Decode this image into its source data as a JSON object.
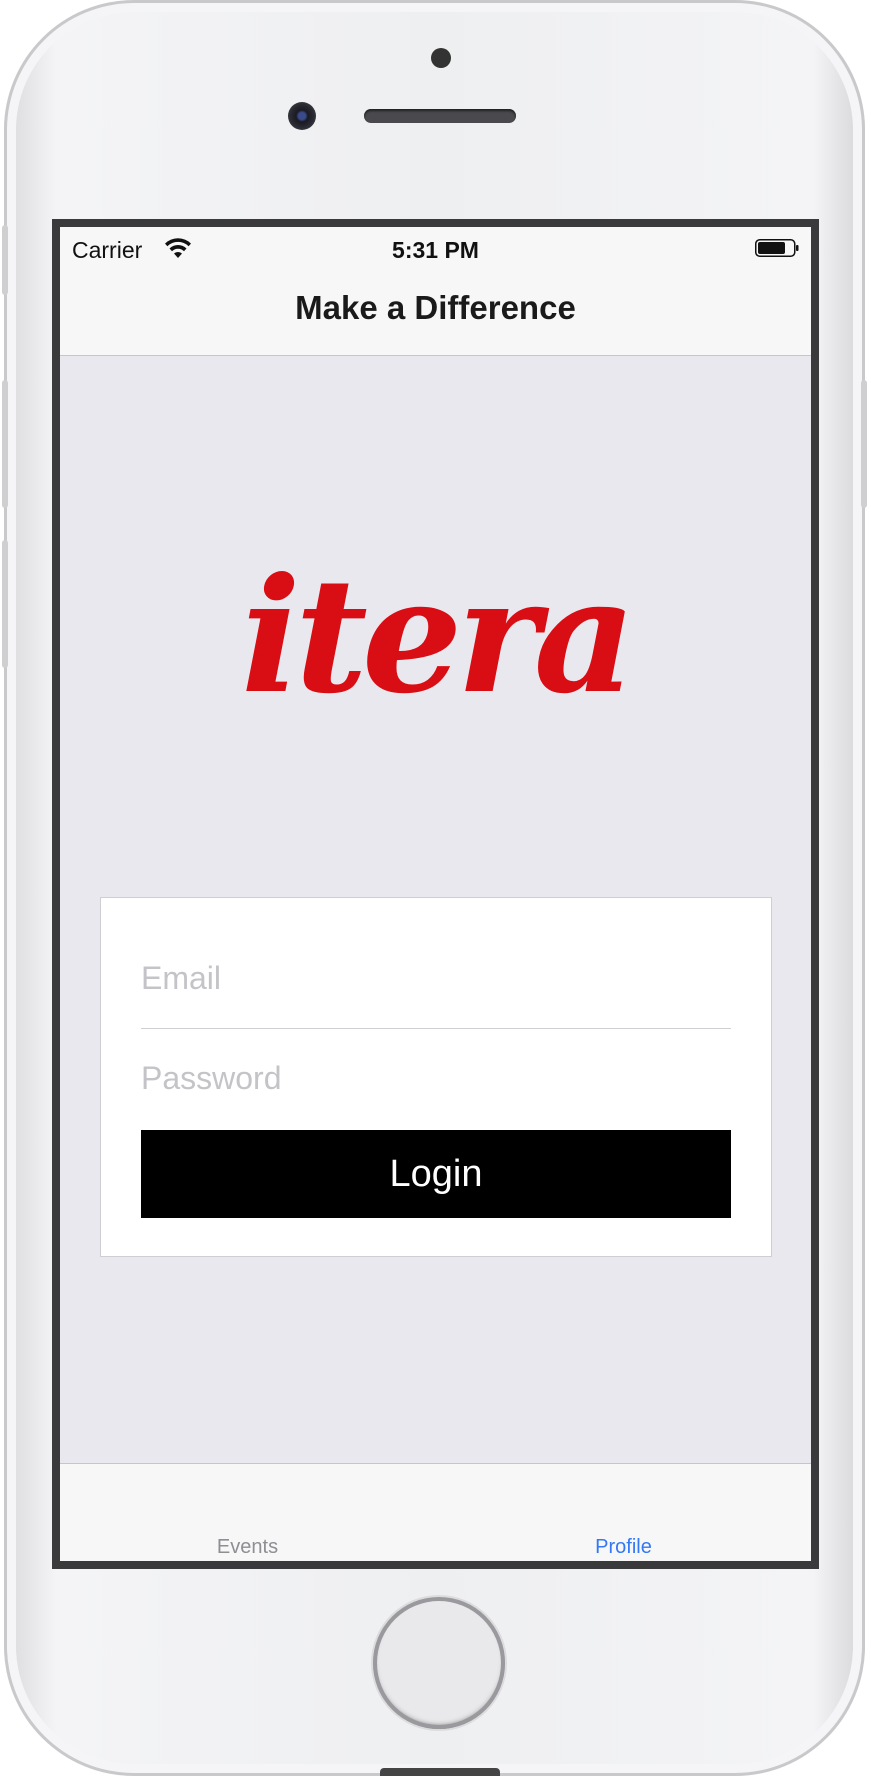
{
  "status_bar": {
    "carrier": "Carrier",
    "time": "5:31 PM",
    "wifi_icon": "wifi-icon",
    "battery_icon": "battery-icon"
  },
  "nav_bar": {
    "title": "Make a Difference"
  },
  "logo": {
    "text": "itera",
    "color": "#d90d14"
  },
  "login_form": {
    "email_placeholder": "Email",
    "email_value": "",
    "password_placeholder": "Password",
    "password_value": "",
    "login_label": "Login"
  },
  "tab_bar": {
    "tabs": [
      {
        "label": "Events",
        "color": "#8e8e93",
        "selected": false
      },
      {
        "label": "Profile",
        "color": "#3478f6",
        "selected": true
      }
    ]
  },
  "colors": {
    "accent": "#3478f6",
    "background": "#e9e8ee",
    "button": "#000000"
  }
}
